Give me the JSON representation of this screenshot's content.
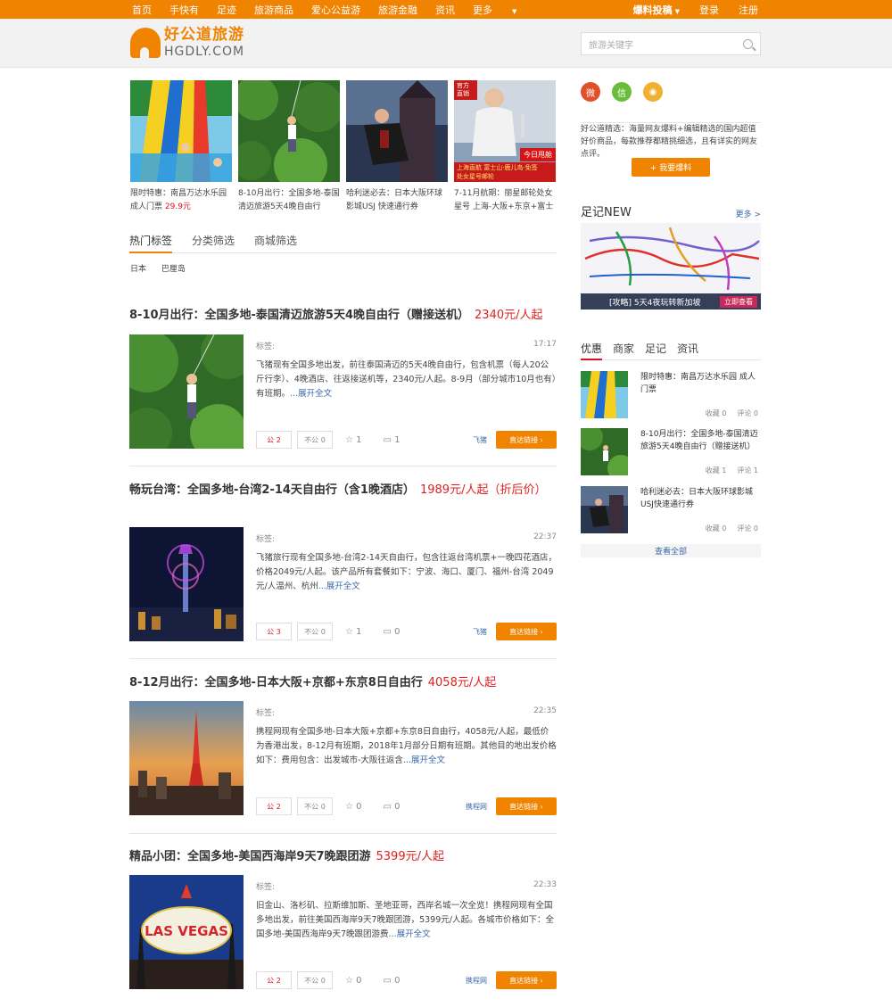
{
  "topbar": {
    "nav": [
      "首页",
      "手快有",
      "足迹",
      "旅游商品",
      "爱心公益游",
      "旅游金融",
      "资讯",
      "更多"
    ],
    "baoliao": "爆料投稿",
    "login": "登录",
    "register": "注册"
  },
  "header": {
    "logo_cn": "好公道旅游",
    "logo_en": "HGDLY.COM",
    "search_placeholder": "旅游关键字"
  },
  "featured": [
    {
      "text": "限时特惠：南昌万达水乐园成人门票",
      "price": "29.9元"
    },
    {
      "text": "8-10月出行：全国多地-泰国清迈旅游5天4晚自由行",
      "price": ""
    },
    {
      "text": "哈利迷必去：日本大阪环球影城USJ 快速通行券",
      "price": ""
    },
    {
      "text": "7-11月航期：丽星邮轮处女星号 上海-大阪+东京+富士",
      "price": "",
      "badge_top": "官方直销",
      "badge_red": "上海直航 富士山·鹿儿岛·免签",
      "badge_yellow": "处女星号邮轮",
      "badge_corner": "今日甩舱"
    }
  ],
  "filter_tabs": [
    "热门标签",
    "分类筛选",
    "商城筛选"
  ],
  "tags": [
    "日本",
    "巴厘岛"
  ],
  "deals": [
    {
      "title": "8-10月出行：全国多地-泰国清迈旅游5天4晚自由行（赠接送机）",
      "price": "2340元/人起",
      "tag_label": "标签:",
      "time": "17:17",
      "desc": "飞猪现有全国多地出发，前往泰国清迈的5天4晚自由行，包含机票（每人20公斤行李）、4晚酒店、往返接送机等，2340元/人起。8-9月（部分城市10月也有）有班期。",
      "more": "...展开全文",
      "good": "公 2",
      "bad": "不公 0",
      "fav": "1",
      "comments": "1",
      "source": "飞猪",
      "go": "直达链接"
    },
    {
      "title": "畅玩台湾：全国多地-台湾2-14天自由行（含1晚酒店）",
      "price": "1989元/人起（折后价）",
      "tag_label": "标签:",
      "time": "22:37",
      "desc": "飞猪旅行现有全国多地-台湾2-14天自由行，包含往返台湾机票+一晚四花酒店，价格2049元/人起。该产品所有套餐如下：宁波、海口、厦门、福州-台湾 2049元/人温州、杭州",
      "more": "...展开全文",
      "good": "公 3",
      "bad": "不公 0",
      "fav": "1",
      "comments": "0",
      "source": "飞猪",
      "go": "直达链接"
    },
    {
      "title": "8-12月出行：全国多地-日本大阪+京都+东京8日自由行",
      "price": "4058元/人起",
      "tag_label": "标签:",
      "time": "22:35",
      "desc": "携程网现有全国多地-日本大阪+京都+东京8日自由行，4058元/人起，最低价为香港出发，8-12月有班期，2018年1月部分日期有班期。其他目的地出发价格如下：费用包含：出发城市-大阪往返含",
      "more": "...展开全文",
      "good": "公 2",
      "bad": "不公 0",
      "fav": "0",
      "comments": "0",
      "source": "携程网",
      "go": "直达链接"
    },
    {
      "title": "精品小团：全国多地-美国西海岸9天7晚跟团游",
      "price": "5399元/人起",
      "tag_label": "标签:",
      "time": "22:33",
      "desc": "旧金山、洛杉矶、拉斯维加斯、圣地亚哥，西岸名城一次全览！携程网现有全国多地出发，前往美国西海岸9天7晚跟团游，5399元/人起。各城市价格如下：全国多地-美国西海岸9天7晚跟团游费",
      "more": "...展开全文",
      "good": "公 2",
      "bad": "不公 0",
      "fav": "0",
      "comments": "0",
      "source": "携程网",
      "go": "直达链接"
    }
  ],
  "sidebar": {
    "intro": "好公道精选：海量网友爆料+编辑精选的国内超值好价商品，每款推荐都精挑细选，且有详实的网友点评。",
    "baoliao_btn": "+ 我要爆料",
    "zuji_title": "足记NEW",
    "zuji_more": "更多 >",
    "zuji_caption": "[攻略] 5天4夜玩转新加坡",
    "zuji_btn": "立即查看",
    "tabs": [
      "优惠",
      "商家",
      "足记",
      "资讯"
    ],
    "items": [
      {
        "title": "限时特惠：南昌万达水乐园 成人门票",
        "fav": "收藏 0",
        "comment": "评论 0"
      },
      {
        "title": "8-10月出行：全国多地-泰国清迈旅游5天4晚自由行（赠接送机）",
        "fav": "收藏 1",
        "comment": "评论 1"
      },
      {
        "title": "哈利迷必去：日本大阪环球影城USJ快速通行券",
        "fav": "收藏 0",
        "comment": "评论 0"
      }
    ],
    "view_all": "查看全部"
  },
  "colors": {
    "accent": "#f08300",
    "price": "#e02020",
    "link": "#3a6aa8"
  }
}
